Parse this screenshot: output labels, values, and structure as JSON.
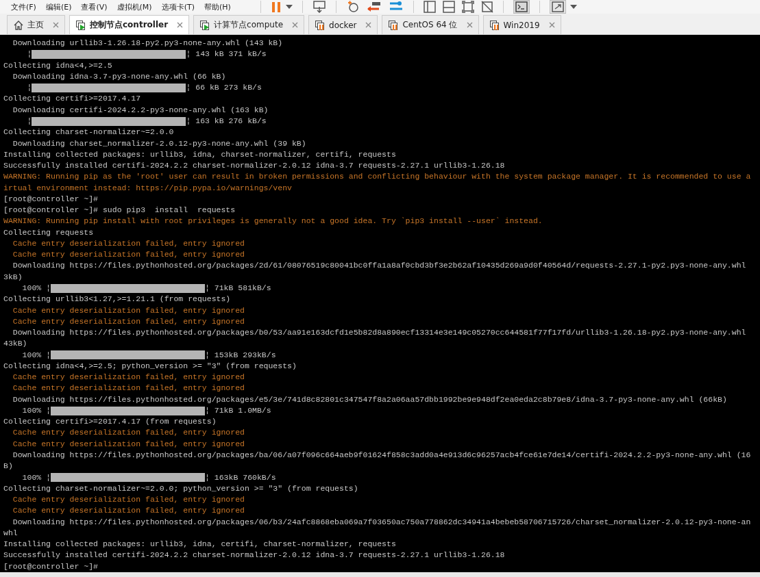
{
  "menu": [
    "文件(F)",
    "编辑(E)",
    "查看(V)",
    "虚拟机(M)",
    "选项卡(T)",
    "帮助(H)"
  ],
  "tabs": [
    {
      "label": "主页",
      "kind": "home",
      "selected": false
    },
    {
      "label": "控制节点controller",
      "kind": "vm",
      "running": true,
      "selected": true
    },
    {
      "label": "计算节点compute",
      "kind": "vm",
      "running": true,
      "selected": false
    },
    {
      "label": "docker",
      "kind": "vm",
      "running": false,
      "selected": false
    },
    {
      "label": "CentOS 64 位",
      "kind": "vm",
      "running": false,
      "selected": false
    },
    {
      "label": "Win2019",
      "kind": "vm",
      "running": false,
      "selected": false
    }
  ],
  "terminal": {
    "lines": [
      {
        "kind": "text",
        "text": "  Downloading urllib3-1.26.18-py2.py3-none-any.whl (143 kB)"
      },
      {
        "kind": "progress",
        "prefix": "     ¦",
        "level": 1,
        "suffix": "¦ 143 kB 371 kB/s"
      },
      {
        "kind": "text",
        "text": "Collecting idna<4,>=2.5"
      },
      {
        "kind": "text",
        "text": "  Downloading idna-3.7-py3-none-any.whl (66 kB)"
      },
      {
        "kind": "progress",
        "prefix": "     ¦",
        "level": 1,
        "suffix": "¦ 66 kB 273 kB/s"
      },
      {
        "kind": "text",
        "text": "Collecting certifi>=2017.4.17"
      },
      {
        "kind": "text",
        "text": "  Downloading certifi-2024.2.2-py3-none-any.whl (163 kB)"
      },
      {
        "kind": "progress",
        "prefix": "     ¦",
        "level": 1,
        "suffix": "¦ 163 kB 276 kB/s"
      },
      {
        "kind": "text",
        "text": "Collecting charset-normalizer~=2.0.0"
      },
      {
        "kind": "text",
        "text": "  Downloading charset_normalizer-2.0.12-py3-none-any.whl (39 kB)"
      },
      {
        "kind": "text",
        "text": "Installing collected packages: urllib3, idna, charset-normalizer, certifi, requests"
      },
      {
        "kind": "text",
        "text": "Successfully installed certifi-2024.2.2 charset-normalizer-2.0.12 idna-3.7 requests-2.27.1 urllib3-1.26.18"
      },
      {
        "kind": "warn",
        "text": "WARNING: Running pip as the 'root' user can result in broken permissions and conflicting behaviour with the system package manager. It is recommended to use a"
      },
      {
        "kind": "warn",
        "text": "irtual environment instead: https://pip.pypa.io/warnings/venv"
      },
      {
        "kind": "text",
        "text": "[root@controller ~]#"
      },
      {
        "kind": "text",
        "text": "[root@controller ~]# sudo pip3  install  requests"
      },
      {
        "kind": "warn",
        "text": "WARNING: Running pip install with root privileges is generally not a good idea. Try `pip3 install --user` instead."
      },
      {
        "kind": "text",
        "text": "Collecting requests"
      },
      {
        "kind": "warn",
        "text": "  Cache entry deserialization failed, entry ignored"
      },
      {
        "kind": "warn",
        "text": "  Cache entry deserialization failed, entry ignored"
      },
      {
        "kind": "text",
        "text": "  Downloading https://files.pythonhosted.org/packages/2d/61/08076519c80041bc0ffa1a8af0cbd3bf3e2b62af10435d269a9d0f40564d/requests-2.27.1-py2.py3-none-any.whl"
      },
      {
        "kind": "text",
        "text": "3kB)"
      },
      {
        "kind": "progress",
        "prefix": "    100% ¦",
        "level": 1,
        "suffix": "¦ 71kB 581kB/s"
      },
      {
        "kind": "text",
        "text": "Collecting urllib3<1.27,>=1.21.1 (from requests)"
      },
      {
        "kind": "warn",
        "text": "  Cache entry deserialization failed, entry ignored"
      },
      {
        "kind": "warn",
        "text": "  Cache entry deserialization failed, entry ignored"
      },
      {
        "kind": "text",
        "text": "  Downloading https://files.pythonhosted.org/packages/b0/53/aa91e163dcfd1e5b82d8a890ecf13314e3e149c05270cc644581f77f17fd/urllib3-1.26.18-py2.py3-none-any.whl"
      },
      {
        "kind": "text",
        "text": "43kB)"
      },
      {
        "kind": "progress",
        "prefix": "    100% ¦",
        "level": 1,
        "suffix": "¦ 153kB 293kB/s"
      },
      {
        "kind": "text",
        "text": "Collecting idna<4,>=2.5; python_version >= \"3\" (from requests)"
      },
      {
        "kind": "warn",
        "text": "  Cache entry deserialization failed, entry ignored"
      },
      {
        "kind": "warn",
        "text": "  Cache entry deserialization failed, entry ignored"
      },
      {
        "kind": "text",
        "text": "  Downloading https://files.pythonhosted.org/packages/e5/3e/741d8c82801c347547f8a2a06aa57dbb1992be9e948df2ea0eda2c8b79e8/idna-3.7-py3-none-any.whl (66kB)"
      },
      {
        "kind": "progress",
        "prefix": "    100% ¦",
        "level": 1,
        "suffix": "¦ 71kB 1.0MB/s"
      },
      {
        "kind": "text",
        "text": "Collecting certifi>=2017.4.17 (from requests)"
      },
      {
        "kind": "warn",
        "text": "  Cache entry deserialization failed, entry ignored"
      },
      {
        "kind": "warn",
        "text": "  Cache entry deserialization failed, entry ignored"
      },
      {
        "kind": "text",
        "text": "  Downloading https://files.pythonhosted.org/packages/ba/06/a07f096c664aeb9f01624f858c3add0a4e913d6c96257acb4fce61e7de14/certifi-2024.2.2-py3-none-any.whl (16"
      },
      {
        "kind": "text",
        "text": "B)"
      },
      {
        "kind": "progress",
        "prefix": "    100% ¦",
        "level": 1,
        "suffix": "¦ 163kB 760kB/s"
      },
      {
        "kind": "text",
        "text": "Collecting charset-normalizer~=2.0.0; python_version >= \"3\" (from requests)"
      },
      {
        "kind": "warn",
        "text": "  Cache entry deserialization failed, entry ignored"
      },
      {
        "kind": "warn",
        "text": "  Cache entry deserialization failed, entry ignored"
      },
      {
        "kind": "text",
        "text": "  Downloading https://files.pythonhosted.org/packages/06/b3/24afc8868eba069a7f03650ac750a778862dc34941a4bebeb58706715726/charset_normalizer-2.0.12-py3-none-an"
      },
      {
        "kind": "text",
        "text": "whl"
      },
      {
        "kind": "text",
        "text": "Installing collected packages: urllib3, idna, certifi, charset-normalizer, requests"
      },
      {
        "kind": "text",
        "text": "Successfully installed certifi-2024.2.2 charset-normalizer-2.0.12 idna-3.7 requests-2.27.1 urllib3-1.26.18"
      },
      {
        "kind": "text",
        "text": "[root@controller ~]#"
      }
    ]
  }
}
